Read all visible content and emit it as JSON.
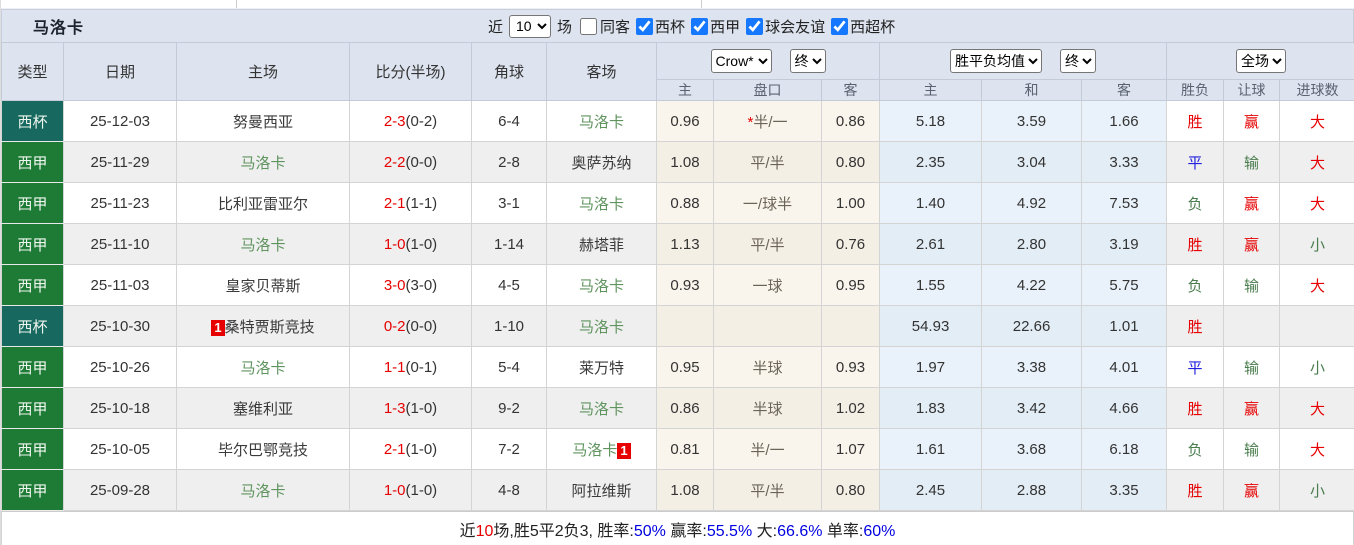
{
  "title": "马洛卡",
  "filters": {
    "near_label": "近",
    "games_count": "10",
    "games_label": "场",
    "same_venue_label": "同客",
    "leagues": [
      {
        "label": "西杯",
        "checked": true
      },
      {
        "label": "西甲",
        "checked": true
      },
      {
        "label": "球会友谊",
        "checked": true
      },
      {
        "label": "西超杯",
        "checked": true
      }
    ]
  },
  "header": {
    "col_type": "类型",
    "col_date": "日期",
    "col_home": "主场",
    "col_score": "比分(半场)",
    "col_corner": "角球",
    "col_away": "客场",
    "crow_select": "Crow*",
    "crow_period_select": "终",
    "avg_select": "胜平负均值",
    "avg_period_select": "终",
    "fulltime_select": "全场",
    "sub_home": "主",
    "sub_handicap": "盘口",
    "sub_away": "客",
    "sub_avg_home": "主",
    "sub_avg_draw": "和",
    "sub_avg_away": "客",
    "col_result": "胜负",
    "col_handicap_result": "让球",
    "col_goals": "进球数"
  },
  "colors": {
    "league_green": "#1e7b36",
    "cup_teal": "#17695f",
    "win_red": "#e60000",
    "draw_blue": "#2121dd",
    "lose_green": "#4a7d4e",
    "self_team_green": "#5f945f",
    "checkbox_blue": "#1677ff"
  },
  "rows": [
    {
      "type": "西杯",
      "type_class": "cup",
      "date": "25-12-03",
      "home": "努曼西亚",
      "home_self": false,
      "home_badge": "",
      "score": "2-3",
      "half": "(0-2)",
      "corner": "6-4",
      "away": "马洛卡",
      "away_self": true,
      "away_badge": "",
      "odds_home": "0.96",
      "star": "*",
      "handicap": "半/一",
      "odds_away": "0.86",
      "avg_home": "5.18",
      "avg_draw": "3.59",
      "avg_away": "1.66",
      "result": "胜",
      "result_color": "red",
      "handicap_result": "赢",
      "handicap_color": "red",
      "goals": "大",
      "goals_color": "red"
    },
    {
      "type": "西甲",
      "type_class": "league",
      "date": "25-11-29",
      "home": "马洛卡",
      "home_self": true,
      "home_badge": "",
      "score": "2-2",
      "half": "(0-0)",
      "corner": "2-8",
      "away": "奥萨苏纳",
      "away_self": false,
      "away_badge": "",
      "odds_home": "1.08",
      "star": "",
      "handicap": "平/半",
      "odds_away": "0.80",
      "avg_home": "2.35",
      "avg_draw": "3.04",
      "avg_away": "3.33",
      "result": "平",
      "result_color": "blue",
      "handicap_result": "输",
      "handicap_color": "green",
      "goals": "大",
      "goals_color": "red"
    },
    {
      "type": "西甲",
      "type_class": "league",
      "date": "25-11-23",
      "home": "比利亚雷亚尔",
      "home_self": false,
      "home_badge": "",
      "score": "2-1",
      "half": "(1-1)",
      "corner": "3-1",
      "away": "马洛卡",
      "away_self": true,
      "away_badge": "",
      "odds_home": "0.88",
      "star": "",
      "handicap": "一/球半",
      "odds_away": "1.00",
      "avg_home": "1.40",
      "avg_draw": "4.92",
      "avg_away": "7.53",
      "result": "负",
      "result_color": "green",
      "handicap_result": "赢",
      "handicap_color": "red",
      "goals": "大",
      "goals_color": "red"
    },
    {
      "type": "西甲",
      "type_class": "league",
      "date": "25-11-10",
      "home": "马洛卡",
      "home_self": true,
      "home_badge": "",
      "score": "1-0",
      "half": "(1-0)",
      "corner": "1-14",
      "away": "赫塔菲",
      "away_self": false,
      "away_badge": "",
      "odds_home": "1.13",
      "star": "",
      "handicap": "平/半",
      "odds_away": "0.76",
      "avg_home": "2.61",
      "avg_draw": "2.80",
      "avg_away": "3.19",
      "result": "胜",
      "result_color": "red",
      "handicap_result": "赢",
      "handicap_color": "red",
      "goals": "小",
      "goals_color": "green"
    },
    {
      "type": "西甲",
      "type_class": "league",
      "date": "25-11-03",
      "home": "皇家贝蒂斯",
      "home_self": false,
      "home_badge": "",
      "score": "3-0",
      "half": "(3-0)",
      "corner": "4-5",
      "away": "马洛卡",
      "away_self": true,
      "away_badge": "",
      "odds_home": "0.93",
      "star": "",
      "handicap": "一球",
      "odds_away": "0.95",
      "avg_home": "1.55",
      "avg_draw": "4.22",
      "avg_away": "5.75",
      "result": "负",
      "result_color": "green",
      "handicap_result": "输",
      "handicap_color": "green",
      "goals": "大",
      "goals_color": "red"
    },
    {
      "type": "西杯",
      "type_class": "cup",
      "date": "25-10-30",
      "home": "桑特贾斯竞技",
      "home_self": false,
      "home_badge": "1",
      "score": "0-2",
      "half": "(0-0)",
      "corner": "1-10",
      "away": "马洛卡",
      "away_self": true,
      "away_badge": "",
      "odds_home": "",
      "star": "",
      "handicap": "",
      "odds_away": "",
      "avg_home": "54.93",
      "avg_draw": "22.66",
      "avg_away": "1.01",
      "result": "胜",
      "result_color": "red",
      "handicap_result": "",
      "handicap_color": "",
      "goals": "",
      "goals_color": ""
    },
    {
      "type": "西甲",
      "type_class": "league",
      "date": "25-10-26",
      "home": "马洛卡",
      "home_self": true,
      "home_badge": "",
      "score": "1-1",
      "half": "(0-1)",
      "corner": "5-4",
      "away": "莱万特",
      "away_self": false,
      "away_badge": "",
      "odds_home": "0.95",
      "star": "",
      "handicap": "半球",
      "odds_away": "0.93",
      "avg_home": "1.97",
      "avg_draw": "3.38",
      "avg_away": "4.01",
      "result": "平",
      "result_color": "blue",
      "handicap_result": "输",
      "handicap_color": "green",
      "goals": "小",
      "goals_color": "green"
    },
    {
      "type": "西甲",
      "type_class": "league",
      "date": "25-10-18",
      "home": "塞维利亚",
      "home_self": false,
      "home_badge": "",
      "score": "1-3",
      "half": "(1-0)",
      "corner": "9-2",
      "away": "马洛卡",
      "away_self": true,
      "away_badge": "",
      "odds_home": "0.86",
      "star": "",
      "handicap": "半球",
      "odds_away": "1.02",
      "avg_home": "1.83",
      "avg_draw": "3.42",
      "avg_away": "4.66",
      "result": "胜",
      "result_color": "red",
      "handicap_result": "赢",
      "handicap_color": "red",
      "goals": "大",
      "goals_color": "red"
    },
    {
      "type": "西甲",
      "type_class": "league",
      "date": "25-10-05",
      "home": "毕尔巴鄂竞技",
      "home_self": false,
      "home_badge": "",
      "score": "2-1",
      "half": "(1-0)",
      "corner": "7-2",
      "away": "马洛卡",
      "away_self": true,
      "away_badge": "1",
      "odds_home": "0.81",
      "star": "",
      "handicap": "半/一",
      "odds_away": "1.07",
      "avg_home": "1.61",
      "avg_draw": "3.68",
      "avg_away": "6.18",
      "result": "负",
      "result_color": "green",
      "handicap_result": "输",
      "handicap_color": "green",
      "goals": "大",
      "goals_color": "red"
    },
    {
      "type": "西甲",
      "type_class": "league",
      "date": "25-09-28",
      "home": "马洛卡",
      "home_self": true,
      "home_badge": "",
      "score": "1-0",
      "half": "(1-0)",
      "corner": "4-8",
      "away": "阿拉维斯",
      "away_self": false,
      "away_badge": "",
      "odds_home": "1.08",
      "star": "",
      "handicap": "平/半",
      "odds_away": "0.80",
      "avg_home": "2.45",
      "avg_draw": "2.88",
      "avg_away": "3.35",
      "result": "胜",
      "result_color": "red",
      "handicap_result": "赢",
      "handicap_color": "red",
      "goals": "小",
      "goals_color": "green"
    }
  ],
  "summary": {
    "parts": [
      {
        "text": "近",
        "color": "dark"
      },
      {
        "text": "10",
        "color": "red"
      },
      {
        "text": "场,胜5平2负3, 胜率:",
        "color": "dark"
      },
      {
        "text": "50%",
        "color": "blue"
      },
      {
        "text": " 赢率:",
        "color": "dark"
      },
      {
        "text": "55.5%",
        "color": "blue"
      },
      {
        "text": " 大:",
        "color": "dark"
      },
      {
        "text": "66.6%",
        "color": "blue"
      },
      {
        "text": " 单率:",
        "color": "dark"
      },
      {
        "text": "60%",
        "color": "blue"
      }
    ]
  }
}
